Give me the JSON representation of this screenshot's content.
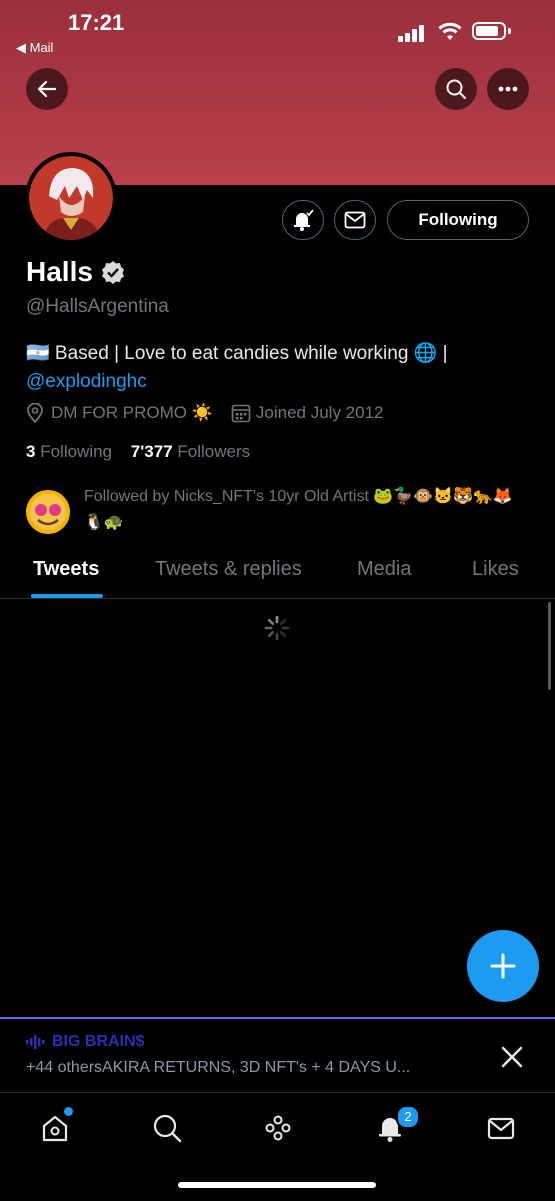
{
  "status": {
    "time": "17:21",
    "back_label": "◀ Mail"
  },
  "profile": {
    "name": "Halls",
    "handle": "@HallsArgentina",
    "bio_text": "🇦🇷 Based | Love to eat candies while working 🌐 |",
    "bio_link": "@explodinghc",
    "location": "DM FOR PROMO ☀️",
    "joined": "Joined July 2012",
    "following_count": "3",
    "following_label": "Following",
    "followers_count": "7'377",
    "followers_label": "Followers",
    "followed_by": "Followed by Nicks_NFT's 10yr Old Artist 🐸🦆🐵🐱🐯🐆🦊🐧🐢",
    "follow_button": "Following"
  },
  "tabs": [
    "Tweets",
    "Tweets & replies",
    "Media",
    "Likes"
  ],
  "space": {
    "title": "BIG BRAIN$",
    "subtitle": "+44 othersAKIRA RETURNS, 3D NFT's + 4 DAYS U..."
  },
  "nav": {
    "notifications_badge": "2"
  },
  "colors": {
    "accent": "#1d9bf0",
    "banner": "#b8404b",
    "space_border": "#7856ff",
    "space_title": "#2c2fb0"
  }
}
